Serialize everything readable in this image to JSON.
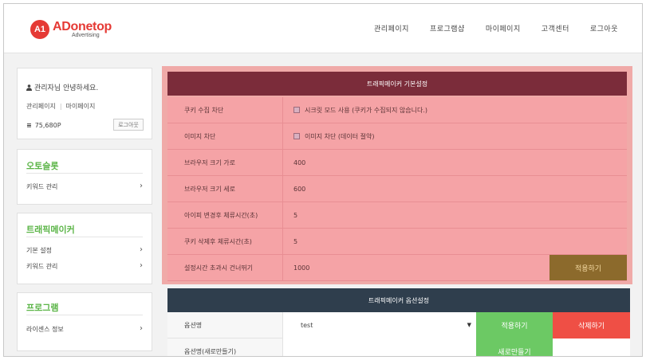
{
  "header": {
    "logo_badge": "A1",
    "logo_main": "ADonetop",
    "logo_sub": "Advertising",
    "nav": [
      "관리페이지",
      "프로그램샵",
      "마이페이지",
      "고객센터",
      "로그아웃"
    ]
  },
  "sidebar": {
    "greeting": "관리자님 안녕하세요.",
    "links": [
      "관리페이지",
      "마이페이지"
    ],
    "points": "75,680P",
    "logout_label": "로그아웃",
    "sections": [
      {
        "title": "오토슬롯",
        "items": [
          "키워드 관리"
        ]
      },
      {
        "title": "트래픽메이커",
        "items": [
          "기본 설정",
          "키워드 관리"
        ]
      },
      {
        "title": "프로그램",
        "items": [
          "라이센스 정보"
        ]
      }
    ]
  },
  "settings": {
    "title": "트래픽메이커 기본설정",
    "rows": [
      {
        "label": "쿠키 수집 차단",
        "value": "시크릿 모드 사용 (쿠키가 수집되지 않습니다.)"
      },
      {
        "label": "이미지 차단",
        "value": "이미지 차단 (데이터 절약)"
      },
      {
        "label": "브라우저 크기 가로",
        "value": "400"
      },
      {
        "label": "브라우저 크기 세로",
        "value": "600"
      },
      {
        "label": "아이피 변경후 체류시간(초)",
        "value": "5"
      },
      {
        "label": "쿠키 삭제후 체류시간(초)",
        "value": "5"
      },
      {
        "label": "설정시간 초과시 건너뛰기",
        "value": "1000"
      }
    ],
    "apply_label": "적용하기"
  },
  "options": {
    "title": "트래픽메이커 옵션설정",
    "rows": [
      {
        "label": "옵션명",
        "value": "test",
        "green": "적용하기",
        "red": "삭제하기"
      },
      {
        "label": "옵션명(새로만들기)",
        "value": "",
        "green": "새로만들기"
      }
    ]
  },
  "colors": {
    "brand_red": "#e53a35",
    "menu_green": "#5cb548",
    "settings_header": "#7b2c3a",
    "settings_row": "#f5a3a6",
    "apply_brown": "#8c6a2c",
    "options_header": "#2f3e4d",
    "btn_green": "#6cc964",
    "btn_red": "#ef4f45"
  }
}
